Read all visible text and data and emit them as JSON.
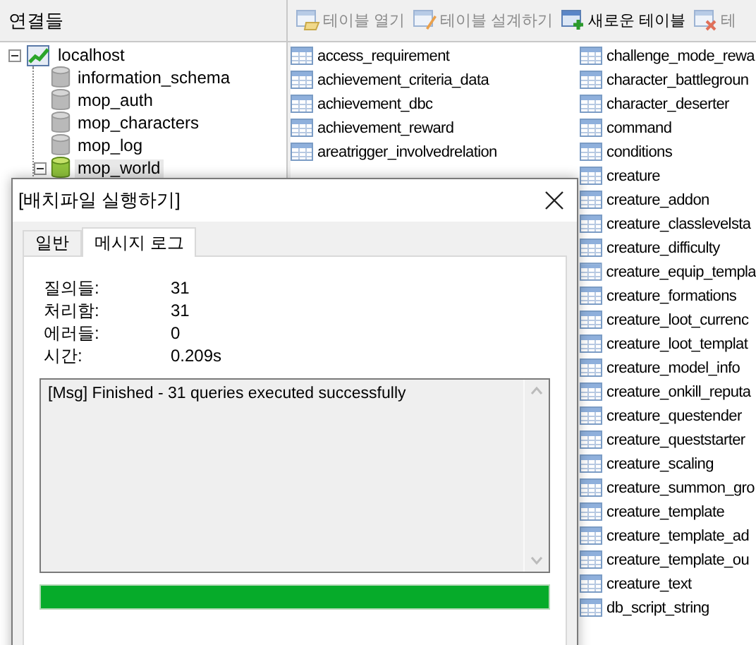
{
  "connections": {
    "title": "연결들",
    "tree": [
      {
        "label": "localhost",
        "kind": "host",
        "expanded": true,
        "selected": false,
        "children": [
          {
            "label": "information_schema",
            "kind": "database",
            "open": false,
            "selected": false
          },
          {
            "label": "mop_auth",
            "kind": "database",
            "open": false,
            "selected": false
          },
          {
            "label": "mop_characters",
            "kind": "database",
            "open": false,
            "selected": false
          },
          {
            "label": "mop_log",
            "kind": "database",
            "open": false,
            "selected": false
          },
          {
            "label": "mop_world",
            "kind": "database",
            "open": true,
            "expanded": true,
            "selected": true
          }
        ]
      }
    ]
  },
  "toolbar": [
    {
      "label": "테이블 열기",
      "kind": "open",
      "disabled": true
    },
    {
      "label": "테이블 설계하기",
      "kind": "design",
      "disabled": true
    },
    {
      "label": "새로운 테이블",
      "kind": "new",
      "disabled": false
    },
    {
      "label": "테",
      "kind": "delete",
      "disabled": true
    }
  ],
  "table_columns": [
    [
      "access_requirement",
      "achievement_criteria_data",
      "achievement_dbc",
      "achievement_reward",
      "areatrigger_involvedrelation"
    ],
    [
      "challenge_mode_rewa",
      "character_battlegroun",
      "character_deserter",
      "command",
      "conditions",
      "creature",
      "creature_addon",
      "creature_classlevelsta",
      "creature_difficulty",
      "creature_equip_templa",
      "creature_formations",
      "creature_loot_currenc",
      "creature_loot_templat",
      "creature_model_info",
      "creature_onkill_reputa",
      "creature_questender",
      "creature_queststarter",
      "creature_scaling",
      "creature_summon_gro",
      "creature_template",
      "creature_template_ad",
      "creature_template_ou",
      "creature_text",
      "db_script_string"
    ]
  ],
  "dialog": {
    "title": "[배치파일 실행하기]",
    "tabs": [
      {
        "label": "일반",
        "selected": false
      },
      {
        "label": "메시지 로그",
        "selected": true
      }
    ],
    "stats": [
      {
        "label": "질의들:",
        "value": "31"
      },
      {
        "label": "처리함:",
        "value": "31"
      },
      {
        "label": "에러들:",
        "value": "0"
      },
      {
        "label": "시간:",
        "value": "0.209s"
      }
    ],
    "log": [
      "[Msg] Finished - 31 queries executed successfully"
    ],
    "progress": {
      "level": 1
    }
  }
}
